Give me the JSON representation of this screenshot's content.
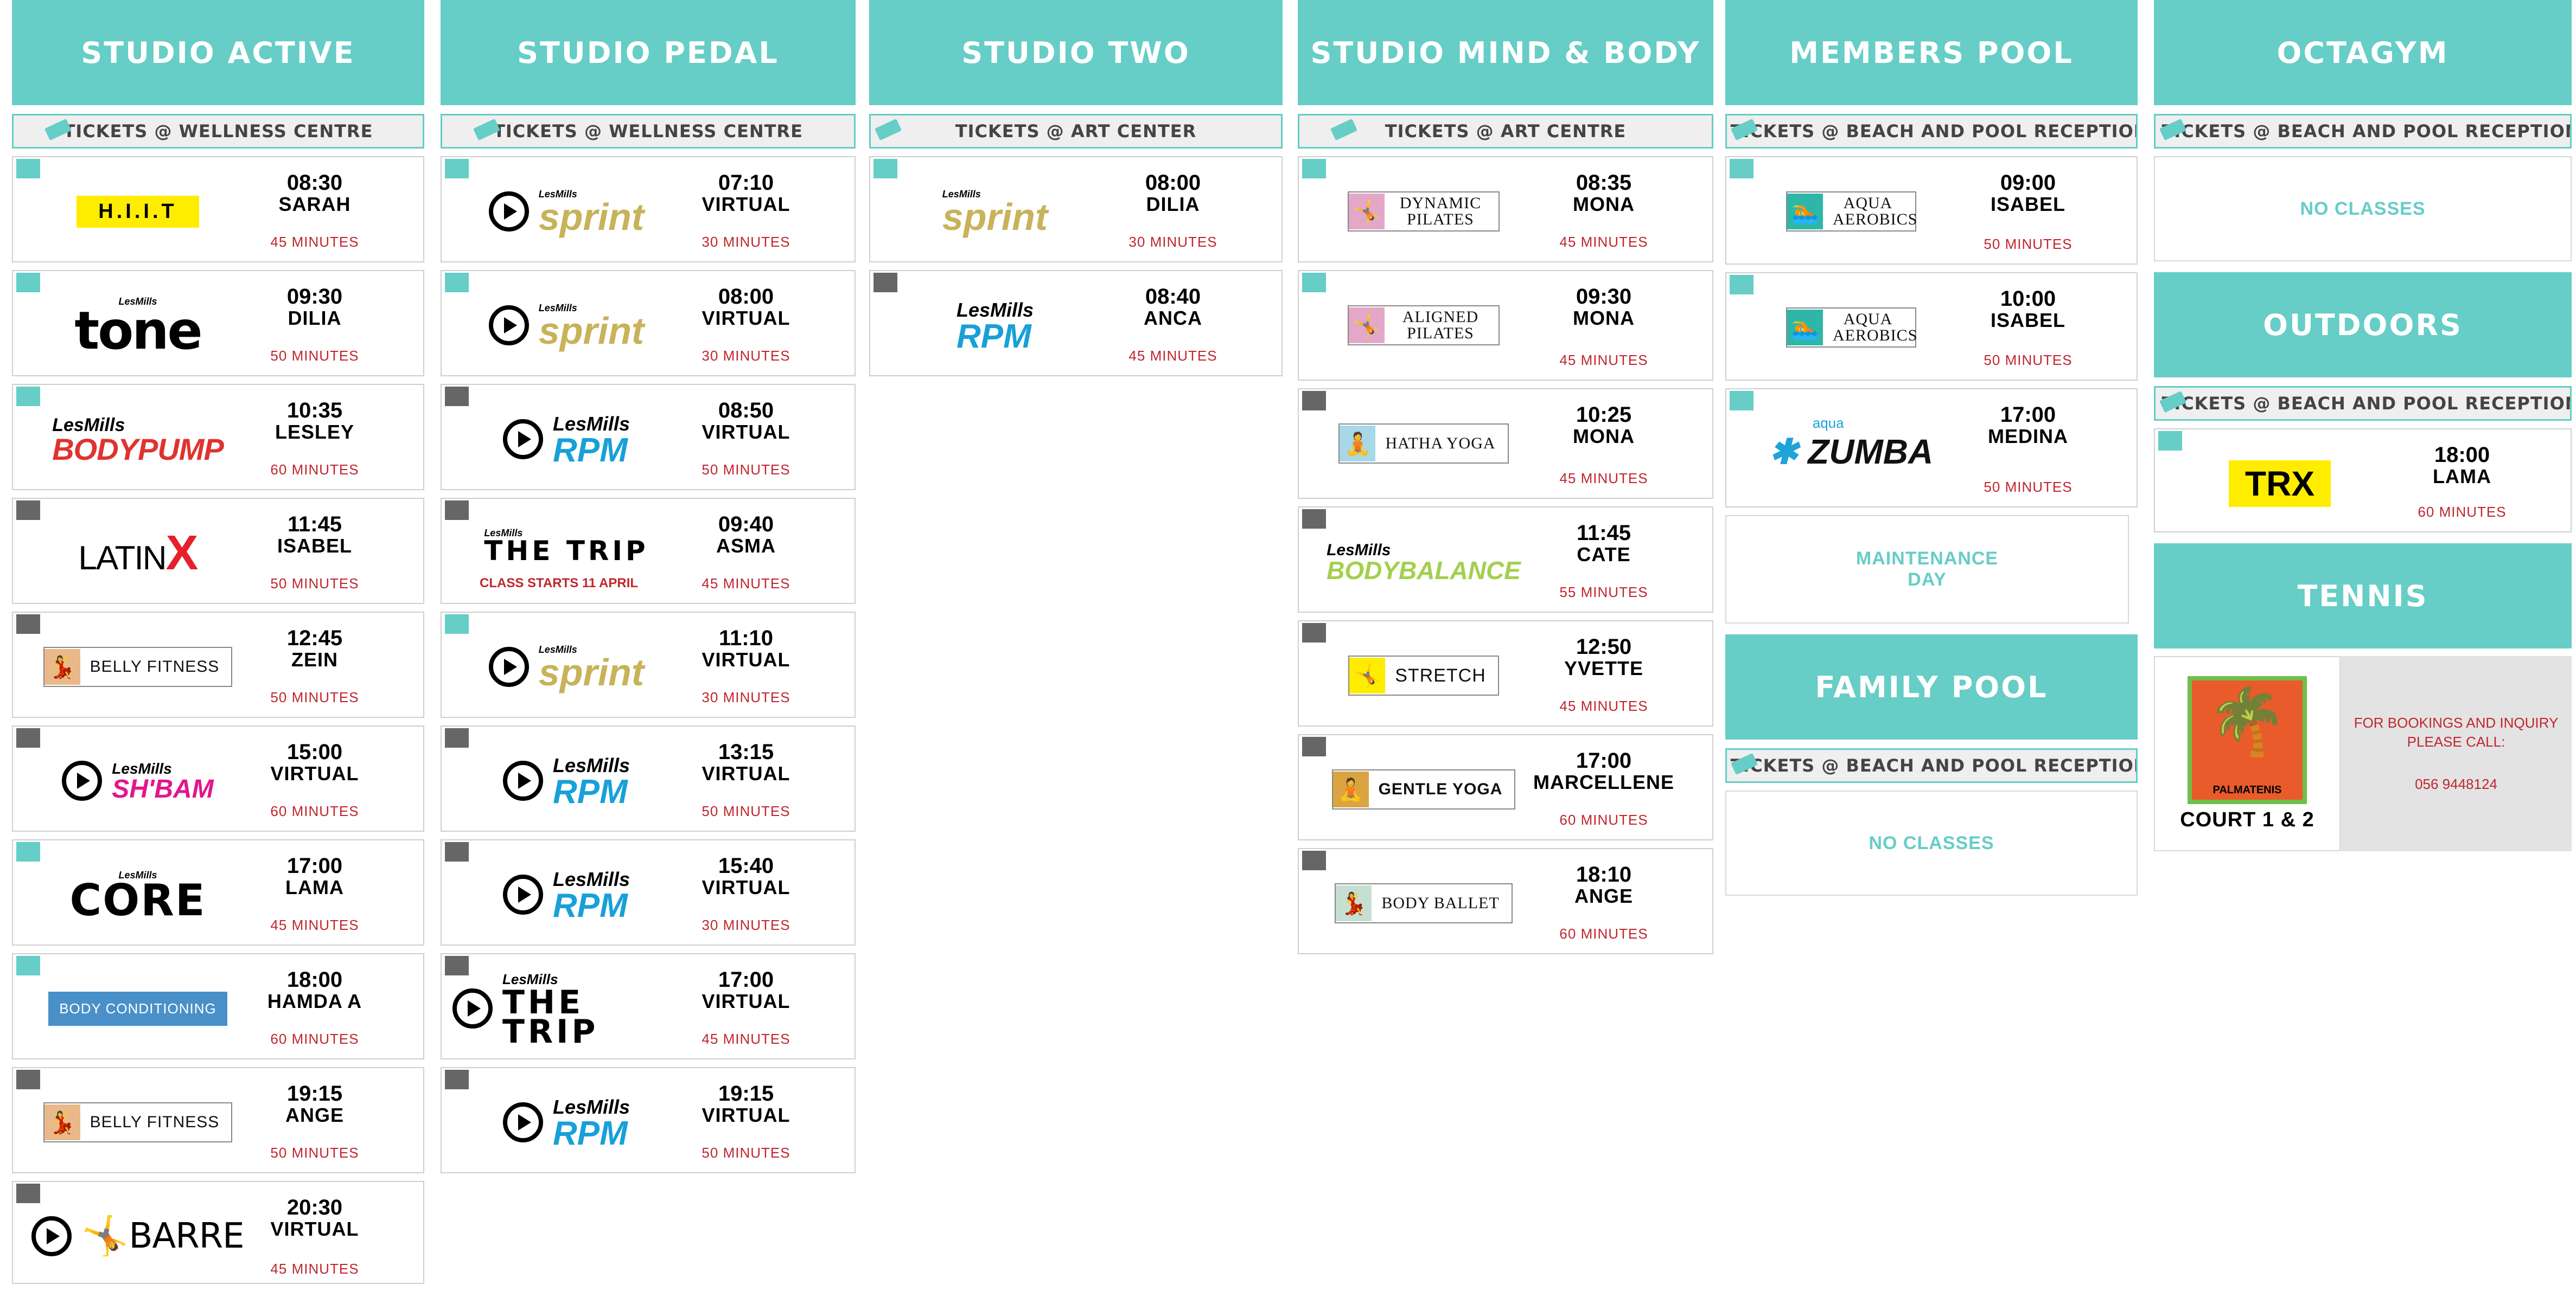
{
  "columns": [
    {
      "id": "studio-active",
      "header": "STUDIO ACTIVE",
      "tickets": "TICKETS @ WELLNESS CENTRE",
      "classes": [
        {
          "logo": "H.I.I.T",
          "time": "08:30",
          "instructor": "SARAH",
          "duration": "45 MINUTES",
          "marker": "teal"
        },
        {
          "logo_small": "LesMills",
          "logo": "tone",
          "time": "09:30",
          "instructor": "DILIA",
          "duration": "50 MINUTES",
          "marker": "teal"
        },
        {
          "logo_small": "LesMills",
          "logo": "BODYPUMP",
          "time": "10:35",
          "instructor": "LESLEY",
          "duration": "60 MINUTES",
          "marker": "teal"
        },
        {
          "logo": "LATIN",
          "logo_x": "X",
          "time": "11:45",
          "instructor": "ISABEL",
          "duration": "50 MINUTES",
          "marker": "grey"
        },
        {
          "logo": "BELLY FITNESS",
          "time": "12:45",
          "instructor": "ZEIN",
          "duration": "50 MINUTES",
          "marker": "grey"
        },
        {
          "logo_small": "LesMills",
          "logo": "SH'BAM",
          "time": "15:00",
          "instructor": "VIRTUAL",
          "duration": "60 MINUTES",
          "marker": "grey"
        },
        {
          "logo_small": "LesMills",
          "logo": "CORE",
          "time": "17:00",
          "instructor": "LAMA",
          "duration": "45 MINUTES",
          "marker": "teal"
        },
        {
          "logo": "BODY CONDITIONING",
          "time": "18:00",
          "instructor": "HAMDA A",
          "duration": "60 MINUTES",
          "marker": "teal"
        },
        {
          "logo": "BELLY FITNESS",
          "time": "19:15",
          "instructor": "ANGE",
          "duration": "50 MINUTES",
          "marker": "grey"
        },
        {
          "logo": "BARRE",
          "time": "20:30",
          "instructor": "VIRTUAL",
          "duration": "45 MINUTES",
          "marker": "grey"
        }
      ]
    },
    {
      "id": "studio-pedal",
      "header": "STUDIO PEDAL",
      "tickets": "TICKETS @ WELLNESS CENTRE",
      "classes": [
        {
          "logo_small": "LesMills",
          "logo": "sprint",
          "time": "07:10",
          "instructor": "VIRTUAL",
          "duration": "30 MINUTES",
          "marker": "teal"
        },
        {
          "logo_small": "LesMills",
          "logo": "sprint",
          "time": "08:00",
          "instructor": "VIRTUAL",
          "duration": "30 MINUTES",
          "marker": "teal"
        },
        {
          "logo_small": "LesMills",
          "logo": "RPM",
          "time": "08:50",
          "instructor": "VIRTUAL",
          "duration": "50 MINUTES",
          "marker": "grey"
        },
        {
          "logo_small": "LesMills",
          "logo": "THE TRIP",
          "note": "CLASS STARTS 11 APRIL",
          "time": "09:40",
          "instructor": "ASMA",
          "duration": "45 MINUTES",
          "marker": "grey"
        },
        {
          "logo_small": "LesMills",
          "logo": "sprint",
          "time": "11:10",
          "instructor": "VIRTUAL",
          "duration": "30 MINUTES",
          "marker": "teal"
        },
        {
          "logo_small": "LesMills",
          "logo": "RPM",
          "time": "13:15",
          "instructor": "VIRTUAL",
          "duration": "50 MINUTES",
          "marker": "grey"
        },
        {
          "logo_small": "LesMills",
          "logo": "RPM",
          "time": "15:40",
          "instructor": "VIRTUAL",
          "duration": "30 MINUTES",
          "marker": "grey"
        },
        {
          "logo_small": "LesMills",
          "logo": "THE TRIP",
          "time": "17:00",
          "instructor": "VIRTUAL",
          "duration": "45 MINUTES",
          "marker": "grey"
        },
        {
          "logo_small": "LesMills",
          "logo": "RPM",
          "time": "19:15",
          "instructor": "VIRTUAL",
          "duration": "50 MINUTES",
          "marker": "grey"
        }
      ]
    },
    {
      "id": "studio-two",
      "header": "STUDIO TWO",
      "tickets": "TICKETS @ ART CENTER",
      "classes": [
        {
          "logo_small": "LesMills",
          "logo": "sprint",
          "time": "08:00",
          "instructor": "DILIA",
          "duration": "30 MINUTES",
          "marker": "teal"
        },
        {
          "logo_small": "LesMills",
          "logo": "RPM",
          "time": "08:40",
          "instructor": "ANCA",
          "duration": "45 MINUTES",
          "marker": "grey"
        }
      ]
    },
    {
      "id": "studio-mind-body",
      "header": "STUDIO MIND & BODY",
      "tickets": "TICKETS @ ART CENTRE",
      "classes": [
        {
          "logo": "DYNAMIC PILATES",
          "time": "08:35",
          "instructor": "MONA",
          "duration": "45 MINUTES",
          "marker": "teal"
        },
        {
          "logo": "ALIGNED PILATES",
          "time": "09:30",
          "instructor": "MONA",
          "duration": "45 MINUTES",
          "marker": "teal"
        },
        {
          "logo": "HATHA YOGA",
          "time": "10:25",
          "instructor": "MONA",
          "duration": "45 MINUTES",
          "marker": "grey"
        },
        {
          "logo_small": "LesMills",
          "logo": "BODYBALANCE",
          "time": "11:45",
          "instructor": "CATE",
          "duration": "55 MINUTES",
          "marker": "grey"
        },
        {
          "logo": "STRETCH",
          "time": "12:50",
          "instructor": "YVETTE",
          "duration": "45 MINUTES",
          "marker": "grey"
        },
        {
          "logo": "GENTLE YOGA",
          "time": "17:00",
          "instructor": "MARCELLENE",
          "duration": "60 MINUTES",
          "marker": "grey"
        },
        {
          "logo": "BODY BALLET",
          "time": "18:10",
          "instructor": "ANGE",
          "duration": "60 MINUTES",
          "marker": "grey"
        }
      ]
    },
    {
      "id": "members-pool",
      "header": "MEMBERS POOL",
      "tickets": "TICKETS @ BEACH AND POOL RECEPTION",
      "classes": [
        {
          "logo": "AQUA AEROBICS",
          "time": "09:00",
          "instructor": "ISABEL",
          "duration": "50 MINUTES",
          "marker": "teal"
        },
        {
          "logo": "AQUA AEROBICS",
          "time": "10:00",
          "instructor": "ISABEL",
          "duration": "50 MINUTES",
          "marker": "teal"
        },
        {
          "logo_small": "aqua",
          "logo": "ZUMBA",
          "time": "17:00",
          "instructor": "MEDINA",
          "duration": "50 MINUTES",
          "marker": "teal"
        }
      ],
      "notice": "MAINTENANCE DAY"
    },
    {
      "id": "family-pool",
      "header": "FAMILY POOL",
      "tickets": "TICKETS @ BEACH AND POOL RECEPTION",
      "notice": "NO CLASSES"
    },
    {
      "id": "octagym",
      "header": "OCTAGYM",
      "tickets": "TICKETS @ BEACH AND POOL RECEPTION",
      "notice": "NO CLASSES"
    },
    {
      "id": "outdoors",
      "header": "OUTDOORS",
      "tickets": "TICKETS @ BEACH AND POOL RECEPTION",
      "classes": [
        {
          "logo": "TRX",
          "time": "18:00",
          "instructor": "LAMA",
          "duration": "60 MINUTES",
          "marker": "teal"
        }
      ]
    },
    {
      "id": "tennis",
      "header": "TENNIS",
      "logo_text": "PALMATENIS",
      "court": "COURT 1 & 2",
      "booking_line1": "FOR BOOKINGS AND INQUIRY",
      "booking_line2": "PLEASE CALL:",
      "phone": "056 9448124"
    }
  ],
  "colors": {
    "header_teal": "#66cdc7",
    "duration_red": "#c0262d",
    "marker_grey": "#666666"
  }
}
